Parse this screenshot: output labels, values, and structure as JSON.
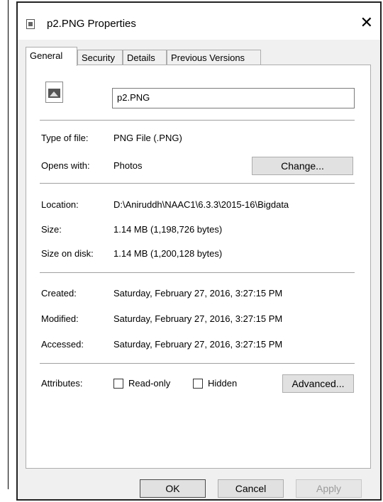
{
  "window": {
    "title": "p2.PNG Properties",
    "close_icon": "close-icon"
  },
  "tabs": [
    {
      "label": "General"
    },
    {
      "label": "Security"
    },
    {
      "label": "Details"
    },
    {
      "label": "Previous Versions"
    }
  ],
  "file": {
    "name": "p2.PNG",
    "icon": "image-file-icon"
  },
  "type_section": {
    "type_label": "Type of file:",
    "type_value": "PNG File (.PNG)",
    "opens_label": "Opens with:",
    "opens_value": "Photos",
    "change_button": "Change..."
  },
  "location_section": {
    "location_label": "Location:",
    "location_value": "D:\\Aniruddh\\NAAC1\\6.3.3\\2015-16\\Bigdata",
    "size_label": "Size:",
    "size_value": "1.14 MB (1,198,726 bytes)",
    "size_disk_label": "Size on disk:",
    "size_disk_value": "1.14 MB (1,200,128 bytes)"
  },
  "dates_section": {
    "created_label": "Created:",
    "created_value": "Saturday, February 27, 2016, 3:27:15 PM",
    "modified_label": "Modified:",
    "modified_value": "Saturday, February 27, 2016, 3:27:15 PM",
    "accessed_label": "Accessed:",
    "accessed_value": "Saturday, February 27, 2016, 3:27:15 PM"
  },
  "attributes": {
    "label": "Attributes:",
    "readonly_label": "Read-only",
    "readonly_checked": false,
    "hidden_label": "Hidden",
    "hidden_checked": false,
    "advanced_button": "Advanced..."
  },
  "footer": {
    "ok": "OK",
    "cancel": "Cancel",
    "apply": "Apply"
  }
}
